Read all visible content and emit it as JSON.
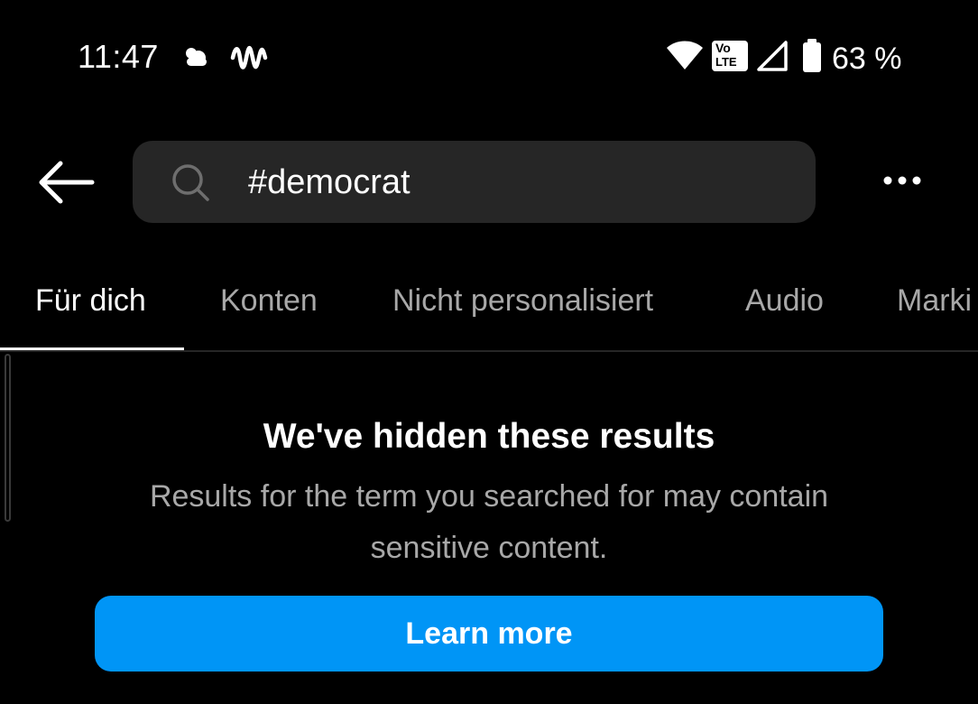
{
  "status_bar": {
    "time": "11:47",
    "battery_percent": "63 %",
    "icons": [
      "weather-cloud-icon",
      "audio-wave-icon",
      "wifi-icon",
      "volte-icon",
      "cell-signal-icon",
      "battery-icon"
    ],
    "volte_label_top": "Vo",
    "volte_label_bottom": "LTE"
  },
  "search": {
    "query": "#democrat",
    "back_icon": "arrow-left-icon",
    "search_icon": "search-icon",
    "more_icon": "more-horizontal-icon"
  },
  "tabs": [
    {
      "label": "Für dich",
      "active": true
    },
    {
      "label": "Konten",
      "active": false
    },
    {
      "label": "Nicht personalisiert",
      "active": false
    },
    {
      "label": "Audio",
      "active": false
    },
    {
      "label": "Marki",
      "active": false
    }
  ],
  "notice": {
    "title": "We've hidden these results",
    "description": "Results for the term you searched for may contain sensitive content.",
    "button_label": "Learn more"
  },
  "colors": {
    "background": "#000000",
    "search_bg": "#262626",
    "inactive_tab": "#a8a8a8",
    "primary_button": "#0095f6",
    "text_primary": "#ffffff",
    "text_secondary": "#a8a8a8"
  }
}
